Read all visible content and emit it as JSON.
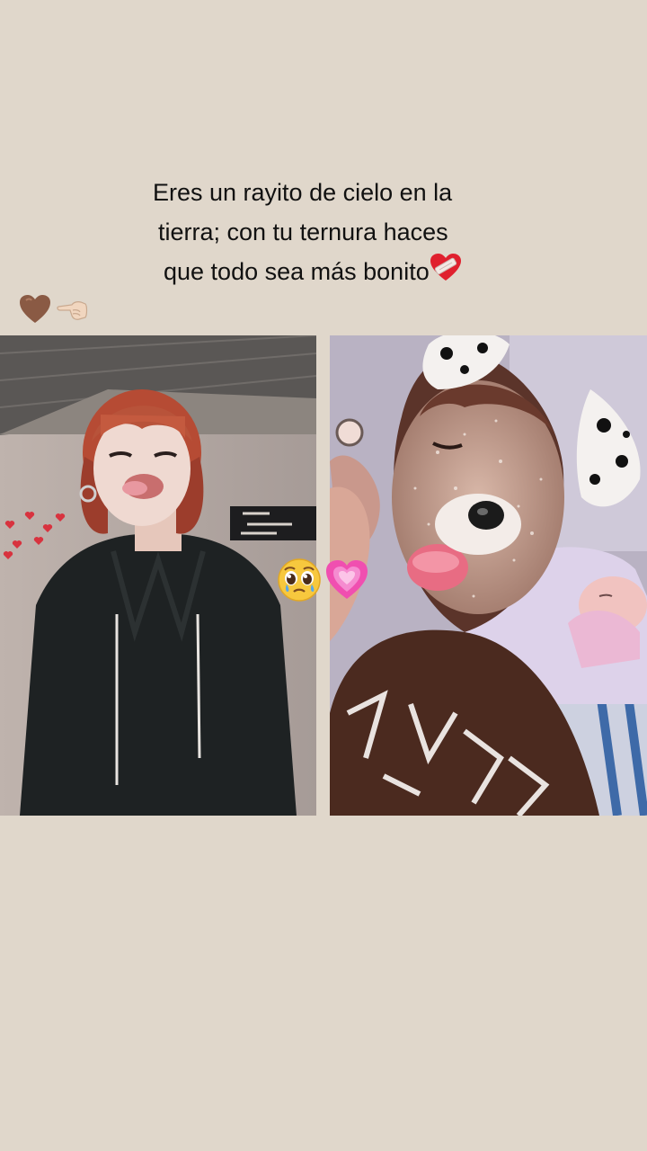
{
  "caption": {
    "line1": "Eres un rayito de cielo en la",
    "line2": "tierra; con tu ternura haces",
    "line3": "que todo sea más bonito"
  },
  "icons": {
    "caption_end": "mending-heart-icon",
    "top_row": [
      "brown-heart-icon",
      "pointing-left-hand-icon"
    ],
    "middle": [
      "pleading-face-icon",
      "growing-heart-icon"
    ]
  },
  "colors": {
    "background": "#e0d7cb",
    "text": "#111111"
  },
  "photos": [
    {
      "subject": "person-in-black-hoodie-with-red-hair"
    },
    {
      "subject": "person-with-dog-filter-and-sleeping-baby"
    }
  ]
}
